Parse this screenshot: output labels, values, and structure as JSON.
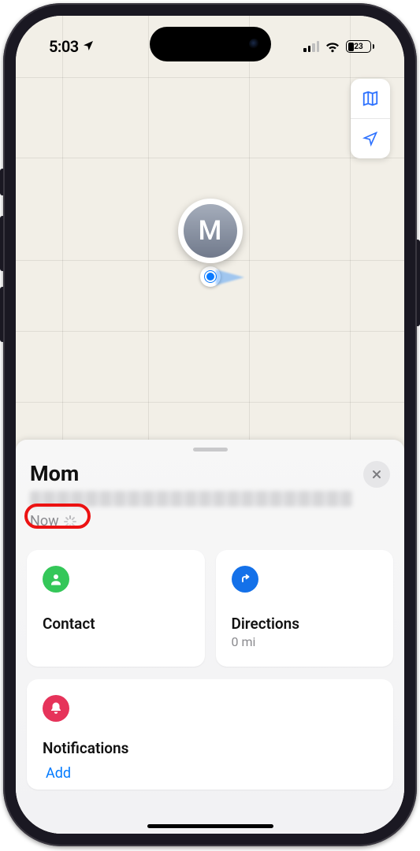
{
  "status": {
    "time": "5:03",
    "battery_percent": "23"
  },
  "map": {
    "avatar_initial": "M"
  },
  "sheet": {
    "title": "Mom",
    "now_label": "Now",
    "contact": {
      "label": "Contact"
    },
    "directions": {
      "label": "Directions",
      "distance": "0 mi"
    },
    "notifications": {
      "label": "Notifications"
    },
    "add_label": "Add"
  }
}
